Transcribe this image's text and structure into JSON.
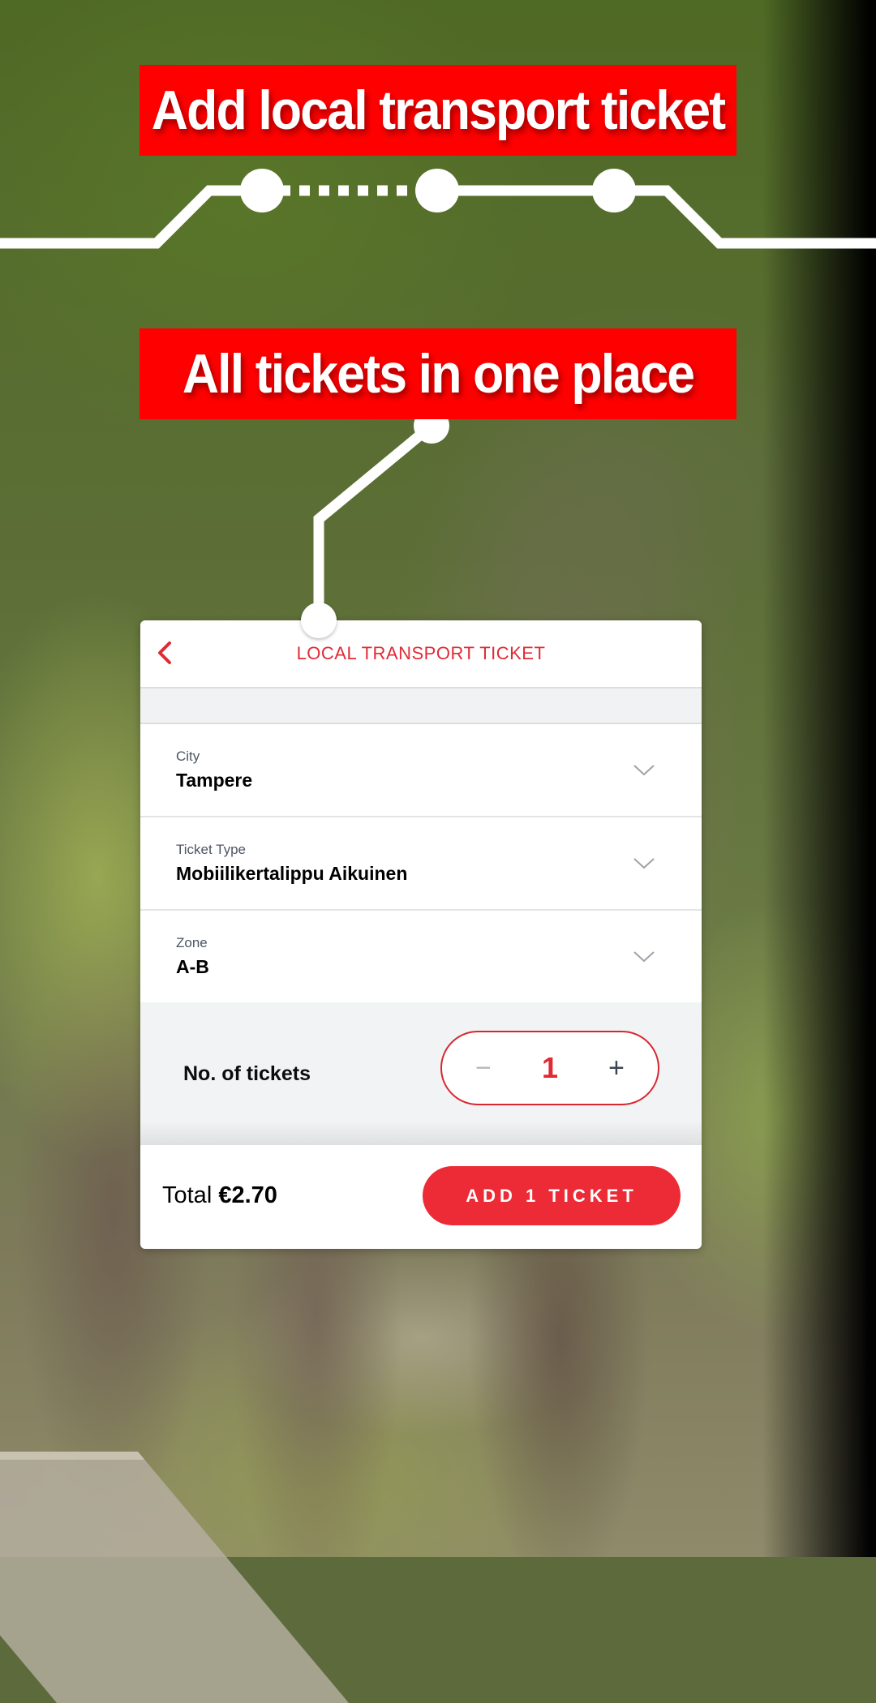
{
  "banners": {
    "top": "Add local transport ticket",
    "middle": "All tickets in one place"
  },
  "colors": {
    "banner_red": "#FF0000",
    "accent_red": "#E02B35",
    "button_red": "#EC2B36"
  },
  "screen": {
    "title": "LOCAL TRANSPORT TICKET",
    "back_icon": "chevron-left-icon",
    "fields": [
      {
        "label": "City",
        "value": "Tampere",
        "icon": "chevron-down-icon"
      },
      {
        "label": "Ticket Type",
        "value": "Mobiilikertalippu Aikuinen",
        "icon": "chevron-down-icon"
      },
      {
        "label": "Zone",
        "value": "A-B",
        "icon": "chevron-down-icon"
      }
    ],
    "quantity": {
      "label": "No. of tickets",
      "value": "1",
      "minus": "−",
      "plus": "+"
    },
    "footer": {
      "total_label": "Total",
      "total_value": "€2.70",
      "add_button": "ADD 1 TICKET"
    }
  }
}
